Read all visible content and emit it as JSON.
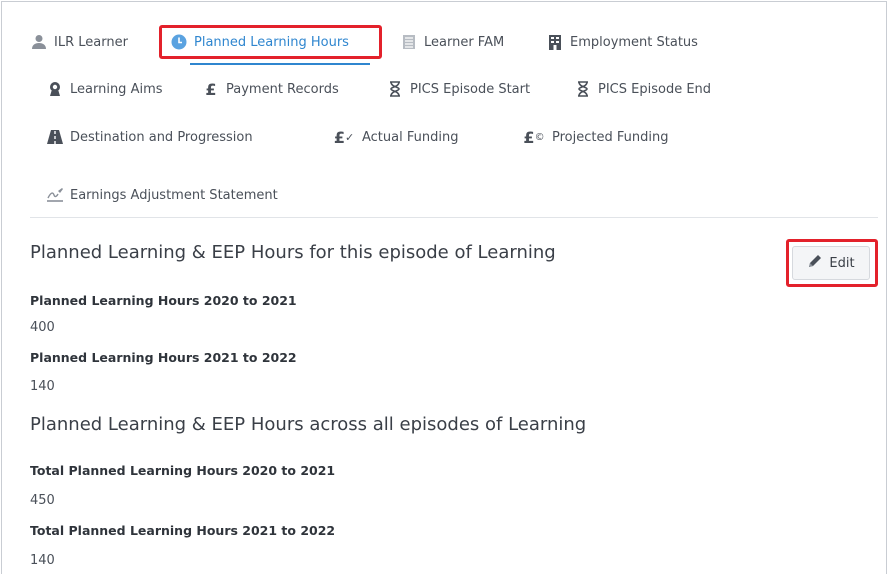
{
  "tabs": [
    {
      "label": "ILR Learner",
      "icon": "user-icon",
      "active": false
    },
    {
      "label": "Planned Learning Hours",
      "icon": "clock-icon",
      "active": true
    },
    {
      "label": "Learner FAM",
      "icon": "list-icon",
      "active": false
    },
    {
      "label": "Employment Status",
      "icon": "building-icon",
      "active": false
    },
    {
      "label": "Learning Aims",
      "icon": "award-icon",
      "active": false
    },
    {
      "label": "Payment Records",
      "icon": "pound-icon",
      "active": false
    },
    {
      "label": "PICS Episode Start",
      "icon": "hourglass-icon",
      "active": false
    },
    {
      "label": "PICS Episode End",
      "icon": "hourglass-icon",
      "active": false
    },
    {
      "label": "Destination and Progression",
      "icon": "road-icon",
      "active": false
    },
    {
      "label": "Actual Funding",
      "icon": "pound-check-icon",
      "active": false
    },
    {
      "label": "Projected Funding",
      "icon": "pound-copyright-icon",
      "active": false
    },
    {
      "label": "Earnings Adjustment Statement",
      "icon": "signature-icon",
      "active": false
    }
  ],
  "colors": {
    "accent": "#2f86cf",
    "highlight": "#e3212b",
    "text": "#3a3f47"
  },
  "episode": {
    "title": "Planned Learning & EEP Hours for this episode of Learning",
    "edit_label": "Edit",
    "fields": [
      {
        "label": "Planned Learning Hours 2020 to 2021",
        "value": "400"
      },
      {
        "label": "Planned Learning Hours 2021 to 2022",
        "value": "140"
      }
    ]
  },
  "all_episodes": {
    "title": "Planned Learning & EEP Hours across all episodes of Learning",
    "fields": [
      {
        "label": "Total Planned Learning Hours 2020 to 2021",
        "value": "450"
      },
      {
        "label": "Total Planned Learning Hours 2021 to 2022",
        "value": "140"
      }
    ]
  }
}
